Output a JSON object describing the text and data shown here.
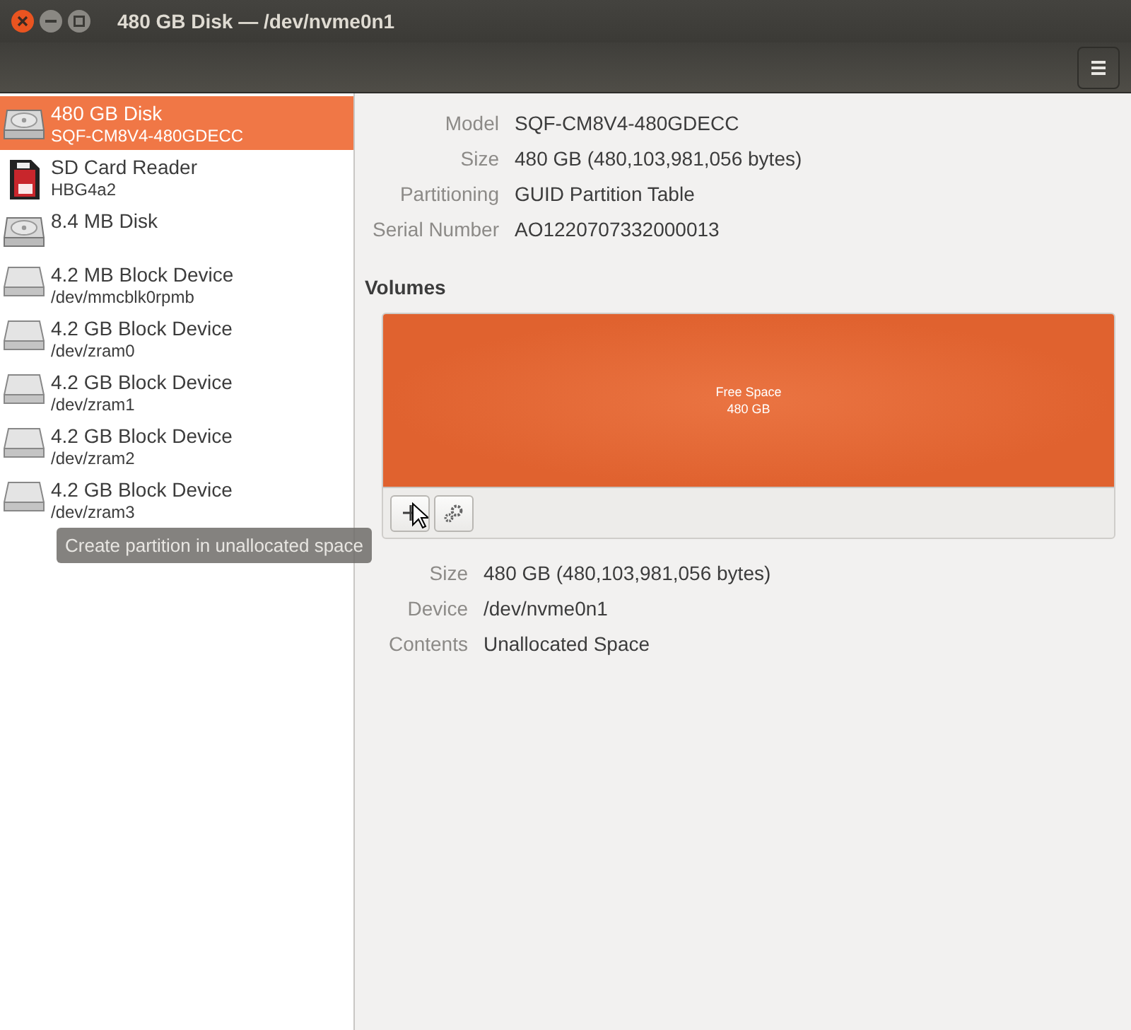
{
  "window": {
    "title": "480 GB Disk — /dev/nvme0n1"
  },
  "devices": [
    {
      "name": "480 GB Disk",
      "detail": "SQF-CM8V4-480GDECC",
      "kind": "hdd",
      "selected": true
    },
    {
      "name": "SD Card Reader",
      "detail": "HBG4a2",
      "kind": "sd",
      "selected": false
    },
    {
      "name": "8.4 MB Disk",
      "kind": "hdd",
      "selected": false
    },
    {
      "name": "4.2 MB Block Device",
      "detail": "/dev/mmcblk0rpmb",
      "kind": "block",
      "selected": false
    },
    {
      "name": "4.2 GB Block Device",
      "detail": "/dev/zram0",
      "kind": "block",
      "selected": false
    },
    {
      "name": "4.2 GB Block Device",
      "detail": "/dev/zram1",
      "kind": "block",
      "selected": false
    },
    {
      "name": "4.2 GB Block Device",
      "detail": "/dev/zram2",
      "kind": "block",
      "selected": false
    },
    {
      "name": "4.2 GB Block Device",
      "detail": "/dev/zram3",
      "kind": "block",
      "selected": false
    }
  ],
  "drive_info": [
    {
      "label": "Model",
      "value": "SQF-CM8V4-480GDECC"
    },
    {
      "label": "Size",
      "value": "480 GB (480,103,981,056 bytes)"
    },
    {
      "label": "Partitioning",
      "value": "GUID Partition Table"
    },
    {
      "label": "Serial Number",
      "value": "AO1220707332000013"
    }
  ],
  "volumes": {
    "title": "Volumes",
    "segments": [
      {
        "label": "Free Space",
        "size": "480 GB"
      }
    ]
  },
  "partition_info": [
    {
      "label": "Size",
      "value": "480 GB (480,103,981,056 bytes)"
    },
    {
      "label": "Device",
      "value": "/dev/nvme0n1"
    },
    {
      "label": "Contents",
      "value": "Unallocated Space"
    }
  ],
  "tooltip": "Create partition in unallocated space"
}
